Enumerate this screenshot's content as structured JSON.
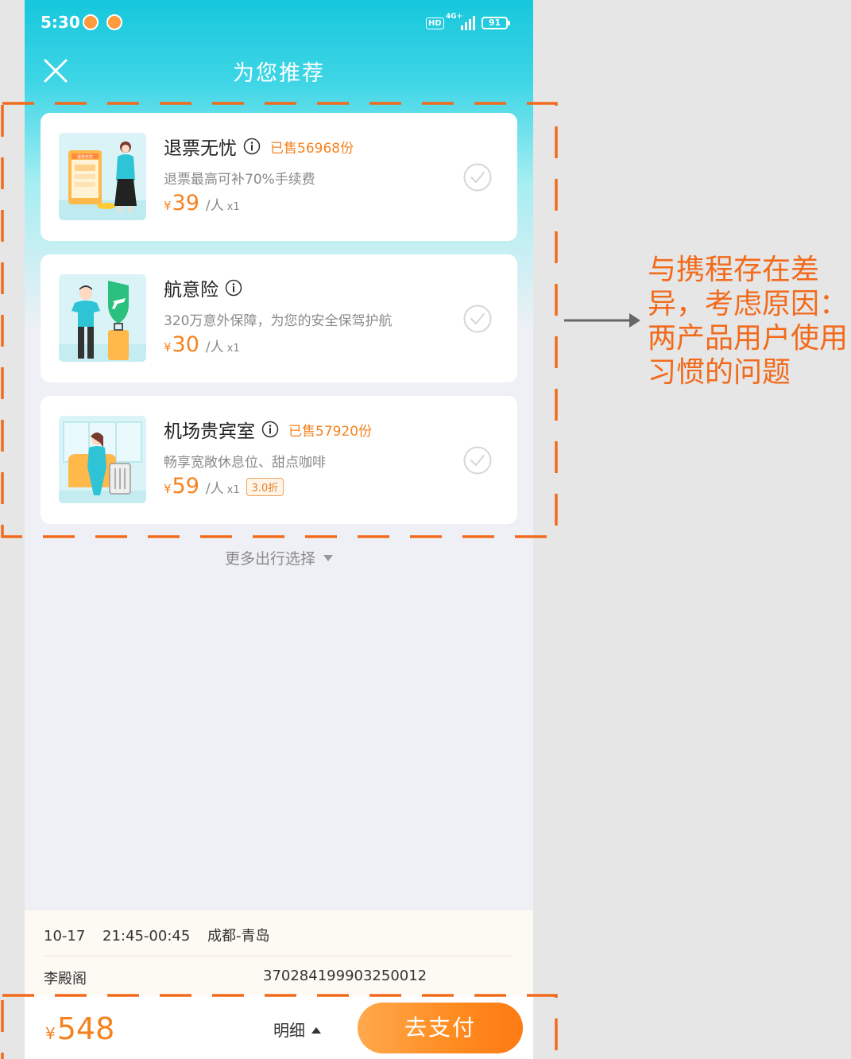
{
  "status_bar": {
    "time": "5:30",
    "hd": "HD",
    "network": "4G+",
    "battery": "91"
  },
  "nav": {
    "title": "为您推荐",
    "close_icon": "close-icon"
  },
  "products": [
    {
      "title": "退票无忧",
      "sold": "已售56968份",
      "subtitle": "退票最高可补70%手续费",
      "currency": "¥",
      "price": "39",
      "unit": "/人",
      "qty": "x1",
      "discount": "",
      "image_text": "退票无忧",
      "selected": false
    },
    {
      "title": "航意险",
      "sold": "",
      "subtitle": "320万意外保障，为您的安全保驾护航",
      "currency": "¥",
      "price": "30",
      "unit": "/人",
      "qty": "x1",
      "discount": "",
      "selected": false
    },
    {
      "title": "机场贵宾室",
      "sold": "已售57920份",
      "subtitle": "畅享宽敞休息位、甜点咖啡",
      "currency": "¥",
      "price": "59",
      "unit": "/人",
      "qty": "x1",
      "discount": "3.0折",
      "selected": false
    }
  ],
  "more_options": "更多出行选择",
  "trip": {
    "date": "10-17",
    "time": "21:45-00:45",
    "route": "成都-青岛",
    "passenger_name": "李殿阁",
    "passenger_id": "370284199903250012"
  },
  "bottom_bar": {
    "currency": "¥",
    "total": "548",
    "detail_label": "明细",
    "pay_label": "去支付"
  },
  "annotation": {
    "text": "与携程存在差异，考虑原因：两产品用户使用习惯的问题",
    "color": "#f26a1b"
  },
  "colors": {
    "accent_orange": "#f5821f",
    "header_cyan": "#16c7dc",
    "dash_orange": "#f26a1b"
  }
}
